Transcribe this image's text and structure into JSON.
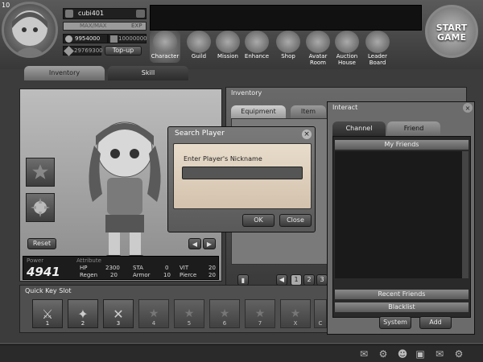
{
  "player": {
    "level": "10",
    "name": "cubi401",
    "exp_label": "MAX/MAX",
    "exp_suffix": "EXP",
    "gold": "9954000",
    "points": "10000000",
    "gems": "29769300",
    "topup_label": "Top-up"
  },
  "start_game": {
    "line1": "START",
    "line2": "GAME"
  },
  "nav": [
    {
      "name": "Character",
      "icon": "character-icon"
    },
    {
      "name": "Guild",
      "icon": "guild-icon"
    },
    {
      "name": "Mission",
      "icon": "mission-icon"
    },
    {
      "name": "Enhance",
      "icon": "enhance-icon"
    },
    {
      "name": "Shop",
      "icon": "shop-icon"
    },
    {
      "name": "Avatar Room",
      "icon": "avatar-room-icon"
    },
    {
      "name": "Auction House",
      "icon": "auction-house-icon"
    },
    {
      "name": "Leader Board",
      "icon": "leaderboard-icon"
    }
  ],
  "tabs": {
    "inventory": "Inventory",
    "skill": "Skill"
  },
  "character": {
    "reset_label": "Reset",
    "power_label": "Power",
    "power_value": "4941",
    "attribute_label": "Attribute",
    "attrs": [
      {
        "name": "HP",
        "value": "2300"
      },
      {
        "name": "STA",
        "value": "0"
      },
      {
        "name": "VIT",
        "value": "20"
      },
      {
        "name": "Regen",
        "value": "20"
      },
      {
        "name": "Armor",
        "value": "10"
      },
      {
        "name": "Pierce",
        "value": "20"
      }
    ]
  },
  "inventory": {
    "title": "Inventory",
    "tab_equipment": "Equipment",
    "tab_item": "Item",
    "pages": [
      "1",
      "2",
      "3"
    ]
  },
  "quick_key": {
    "title": "Quick Key Slot",
    "slots": [
      "1",
      "2",
      "3",
      "4",
      "5",
      "6",
      "7",
      "X",
      "C"
    ]
  },
  "interact": {
    "title": "Interact",
    "tab_channel": "Channel",
    "tab_friend": "Friend",
    "my_friends": "My Friends",
    "recent_friends": "Recent Friends",
    "blacklist": "Blacklist",
    "system_label": "System",
    "add_label": "Add"
  },
  "dialog": {
    "title": "Search Player",
    "prompt": "Enter Player's Nickname",
    "input_value": "",
    "ok_label": "OK",
    "close_label": "Close"
  }
}
